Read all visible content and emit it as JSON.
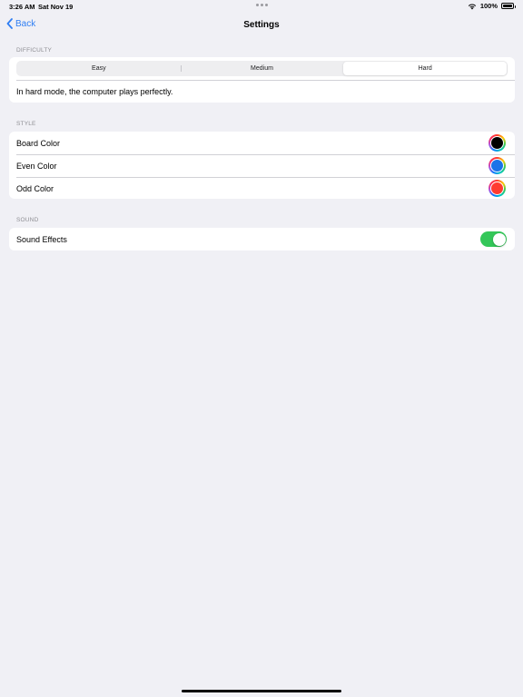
{
  "status_bar": {
    "time": "3:26 AM",
    "date": "Sat Nov 19",
    "battery": "100%"
  },
  "nav": {
    "back_label": "Back",
    "title": "Settings"
  },
  "difficulty": {
    "header": "DIFFICULTY",
    "options": [
      "Easy",
      "Medium",
      "Hard"
    ],
    "selected": "Hard",
    "description": "In hard mode, the computer plays perfectly."
  },
  "style": {
    "header": "STYLE",
    "rows": [
      {
        "label": "Board Color",
        "color": "#000000"
      },
      {
        "label": "Even Color",
        "color": "#1a73e8"
      },
      {
        "label": "Odd Color",
        "color": "#ff3b30"
      }
    ]
  },
  "sound": {
    "header": "SOUND",
    "sound_effects_label": "Sound Effects",
    "sound_effects_on": true,
    "toggle_on_color": "#34c759"
  },
  "colors": {
    "accent": "#2f7ef3",
    "background": "#f0f0f5"
  }
}
